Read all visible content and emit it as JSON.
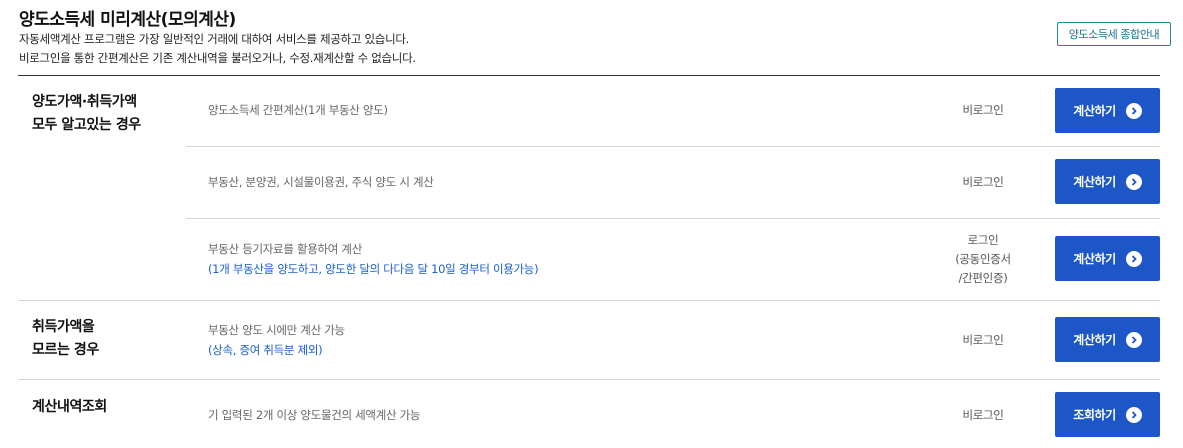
{
  "header": {
    "title": "양도소득세 미리계산(모의계산)",
    "desc1": "자동세액계산 프로그램은 가장 일반적인 거래에 대하여 서비스를 제공하고 있습니다.",
    "desc2": "비로그인을 통한 간편계산은 기존 계산내역을 불러오거나, 수정.재계산할 수 없습니다.",
    "guide_button": "양도소득세 종합안내"
  },
  "sections": {
    "known": {
      "line1": "양도가액·취득가액",
      "line2": "모두 알고있는 경우"
    },
    "unknown": {
      "line1": "취득가액을",
      "line2": "모르는 경우"
    },
    "history": {
      "line1": "계산내역조회"
    }
  },
  "rows": [
    {
      "desc": "양도소득세 간편계산(1개 부동산 양도)",
      "note": "",
      "login": [
        "비로그인"
      ],
      "button": "계산하기"
    },
    {
      "desc": "부동산, 분양권, 시설물이용권, 주식 양도 시 계산",
      "note": "",
      "login": [
        "비로그인"
      ],
      "button": "계산하기"
    },
    {
      "desc": "부동산 등기자료를 활용하여 계산",
      "note": "(1개 부동산을 양도하고, 양도한 달의 다다음 달 10일 경부터 이용가능)",
      "login": [
        "로그인",
        "(공동인증서",
        "/간편인증)"
      ],
      "button": "계산하기"
    },
    {
      "desc": "부동산 양도 시에만 계산 가능",
      "note": "(상속, 증여 취득분 제외)",
      "login": [
        "비로그인"
      ],
      "button": "계산하기"
    },
    {
      "desc": "기 입력된 2개 이상 양도물건의 세액계산 가능",
      "note": "",
      "login": [
        "비로그인"
      ],
      "button": "조회하기"
    }
  ],
  "colors": {
    "primary_button": "#1d57c7",
    "note_text": "#1a5fd1",
    "guide_border": "#1f8a8a"
  }
}
